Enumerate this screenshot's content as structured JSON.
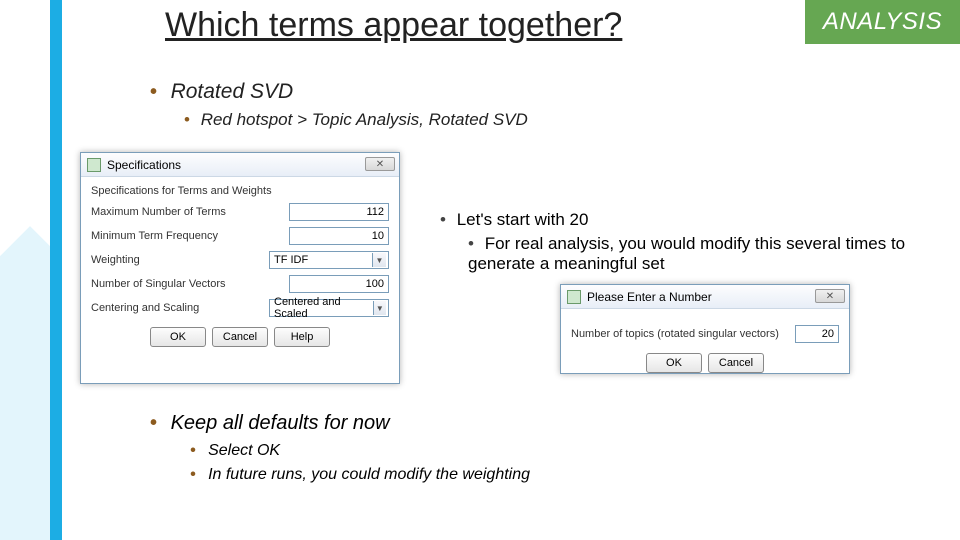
{
  "badge": "ANALYSIS",
  "title": "Which terms appear together?",
  "bullet1": "Rotated SVD",
  "bullet2": "Red hotspot > Topic Analysis, Rotated SVD",
  "right1": "Let's start with 20",
  "right2": "For real analysis, you would modify this several times to generate a meaningful set",
  "bullet3": "Keep all defaults for now",
  "bullet4": "Select OK",
  "bullet5": "In future runs, you could modify the weighting",
  "dlg1": {
    "title": "Specifications",
    "section": "Specifications for Terms and Weights",
    "rows": {
      "maxTermsLabel": "Maximum Number of Terms",
      "maxTermsValue": "112",
      "minFreqLabel": "Minimum Term Frequency",
      "minFreqValue": "10",
      "weightingLabel": "Weighting",
      "weightingValue": "TF IDF",
      "svLabel": "Number of Singular Vectors",
      "svValue": "100",
      "centerLabel": "Centering and Scaling",
      "centerValue": "Centered and Scaled"
    },
    "ok": "OK",
    "cancel": "Cancel",
    "help": "Help"
  },
  "dlg2": {
    "title": "Please Enter a Number",
    "label": "Number of topics (rotated singular vectors)",
    "value": "20",
    "ok": "OK",
    "cancel": "Cancel"
  }
}
